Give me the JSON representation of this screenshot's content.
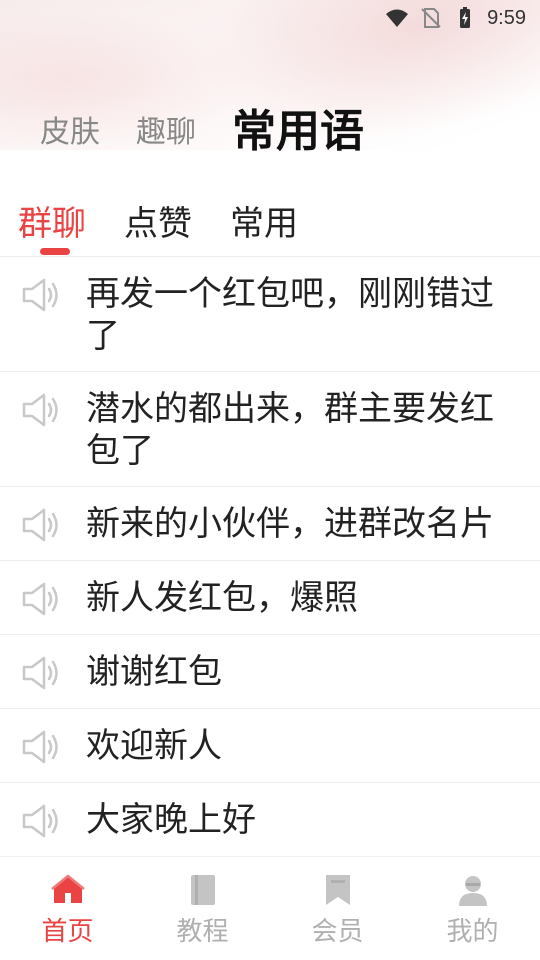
{
  "status_bar": {
    "time": "9:59"
  },
  "top_tabs": [
    {
      "label": "皮肤"
    },
    {
      "label": "趣聊"
    },
    {
      "label": "常用语"
    }
  ],
  "sub_tabs": [
    {
      "label": "群聊"
    },
    {
      "label": "点赞"
    },
    {
      "label": "常用"
    }
  ],
  "phrases": [
    {
      "text": "再发一个红包吧，刚刚错过了"
    },
    {
      "text": "潜水的都出来，群主要发红包了"
    },
    {
      "text": "新来的小伙伴，进群改名片"
    },
    {
      "text": "新人发红包，爆照"
    },
    {
      "text": "谢谢红包"
    },
    {
      "text": "欢迎新人"
    },
    {
      "text": "大家晚上好"
    }
  ],
  "bottom_nav": [
    {
      "label": "首页",
      "icon": "home-icon"
    },
    {
      "label": "教程",
      "icon": "book-icon"
    },
    {
      "label": "会员",
      "icon": "bookmark-icon"
    },
    {
      "label": "我的",
      "icon": "user-icon"
    }
  ],
  "colors": {
    "accent": "#ea4343",
    "inactive": "#b0b0b0"
  }
}
